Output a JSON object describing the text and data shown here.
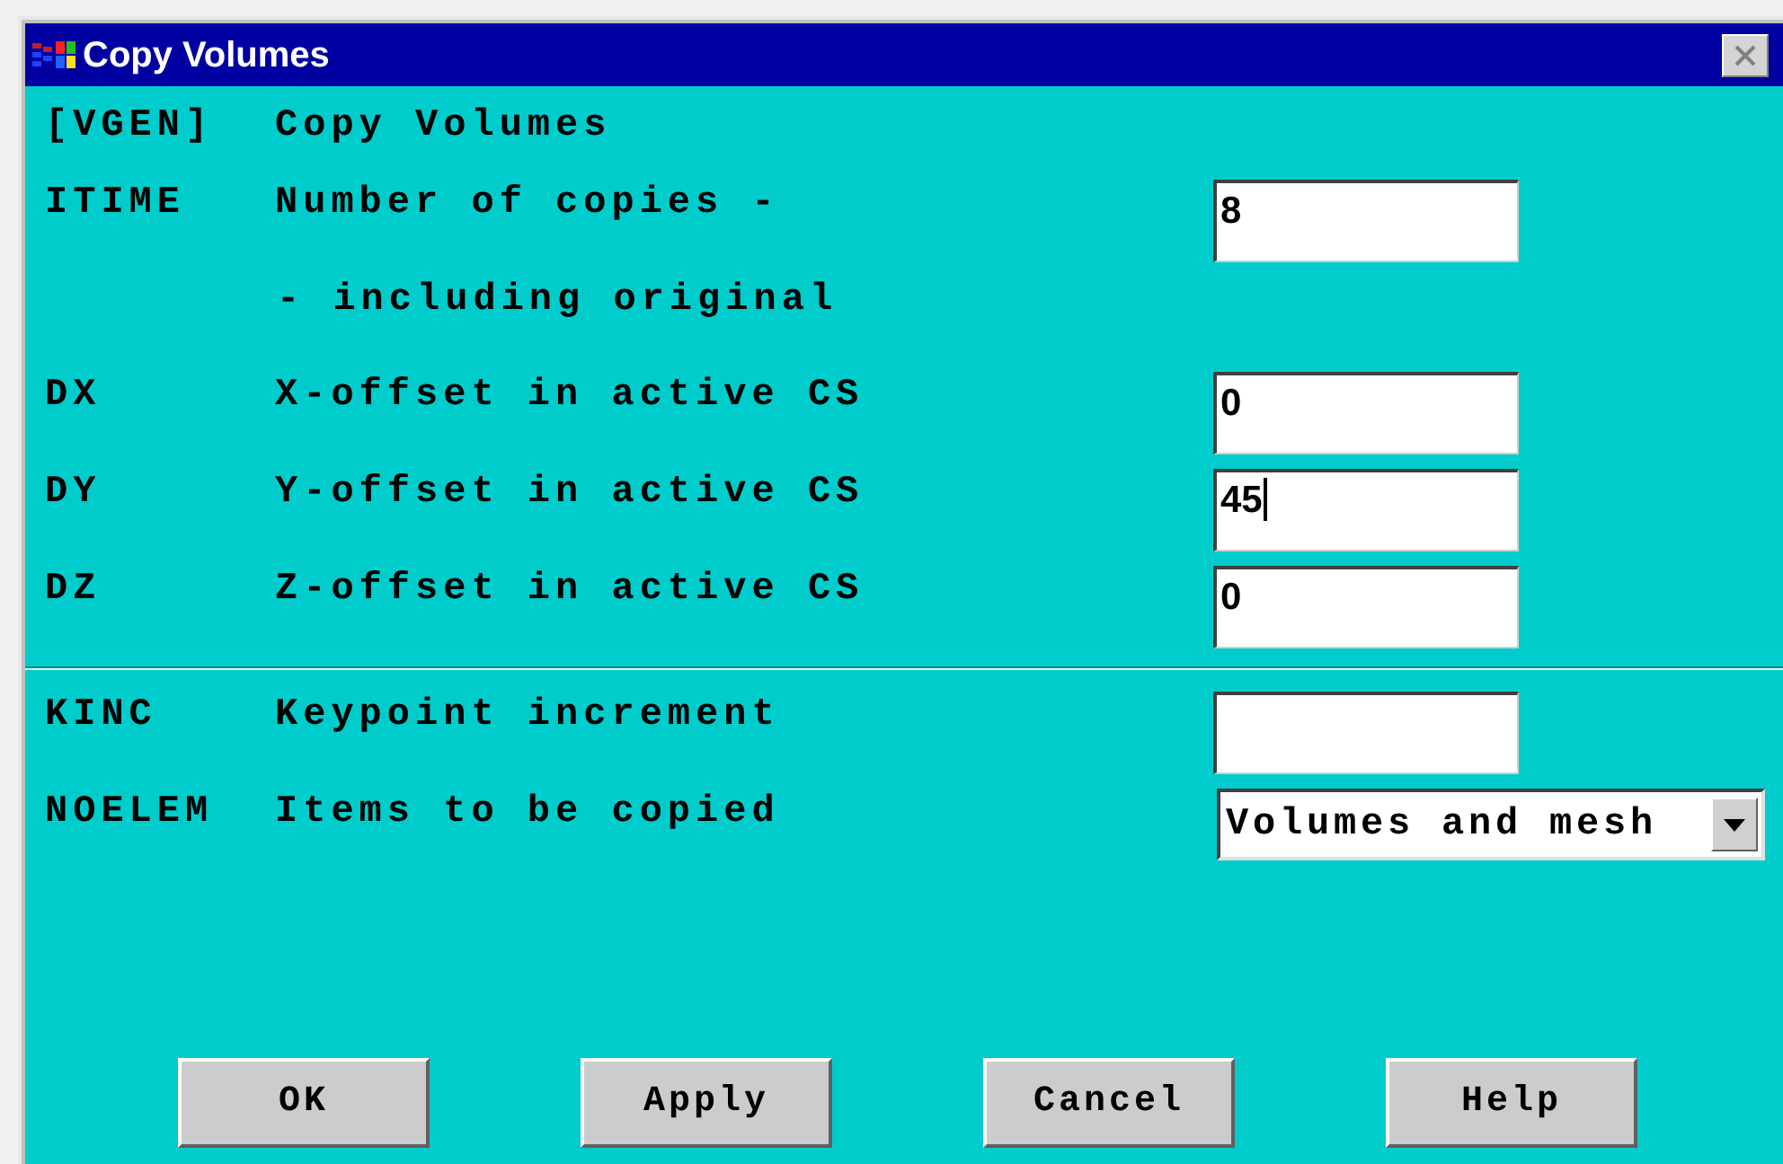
{
  "window": {
    "title": "Copy Volumes"
  },
  "sections": [
    [
      {
        "kind": "heading",
        "code": "[VGEN]",
        "label": "Copy Volumes"
      },
      {
        "kind": "field",
        "code": "ITIME",
        "label": "Number of copies -",
        "value": "8",
        "focused": false
      },
      {
        "kind": "note",
        "label": "- including original"
      },
      {
        "kind": "field",
        "code": "DX",
        "label": "X-offset in active CS",
        "value": "0",
        "focused": false
      },
      {
        "kind": "field",
        "code": "DY",
        "label": "Y-offset in active CS",
        "value": "45",
        "focused": true
      },
      {
        "kind": "field",
        "code": "DZ",
        "label": "Z-offset in active CS",
        "value": "0",
        "focused": false
      }
    ],
    [
      {
        "kind": "field",
        "code": "KINC",
        "label": "Keypoint increment",
        "focused": false
      },
      {
        "kind": "dropdown",
        "code": "NOELEM",
        "label": "Items to be copied",
        "value": "Volumes and mesh"
      }
    ]
  ],
  "buttons": [
    "OK",
    "Apply",
    "Cancel",
    "Help"
  ]
}
